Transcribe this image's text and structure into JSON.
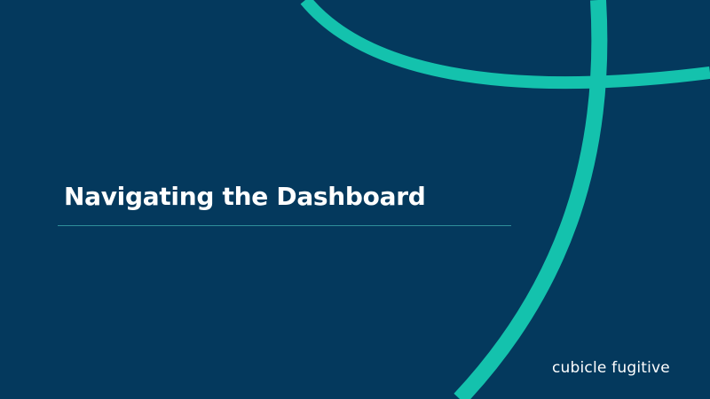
{
  "slide": {
    "title": "Navigating the Dashboard",
    "brand_logo_text": "cubicle fugitive"
  },
  "colors": {
    "background": "#04395d",
    "accent": "#14c2ad",
    "title_text": "#ffffff",
    "divider": "#2f8f9a",
    "logo_text": "#ffffff"
  },
  "decorations": {
    "graphic": "teal-swoosh-curves"
  }
}
